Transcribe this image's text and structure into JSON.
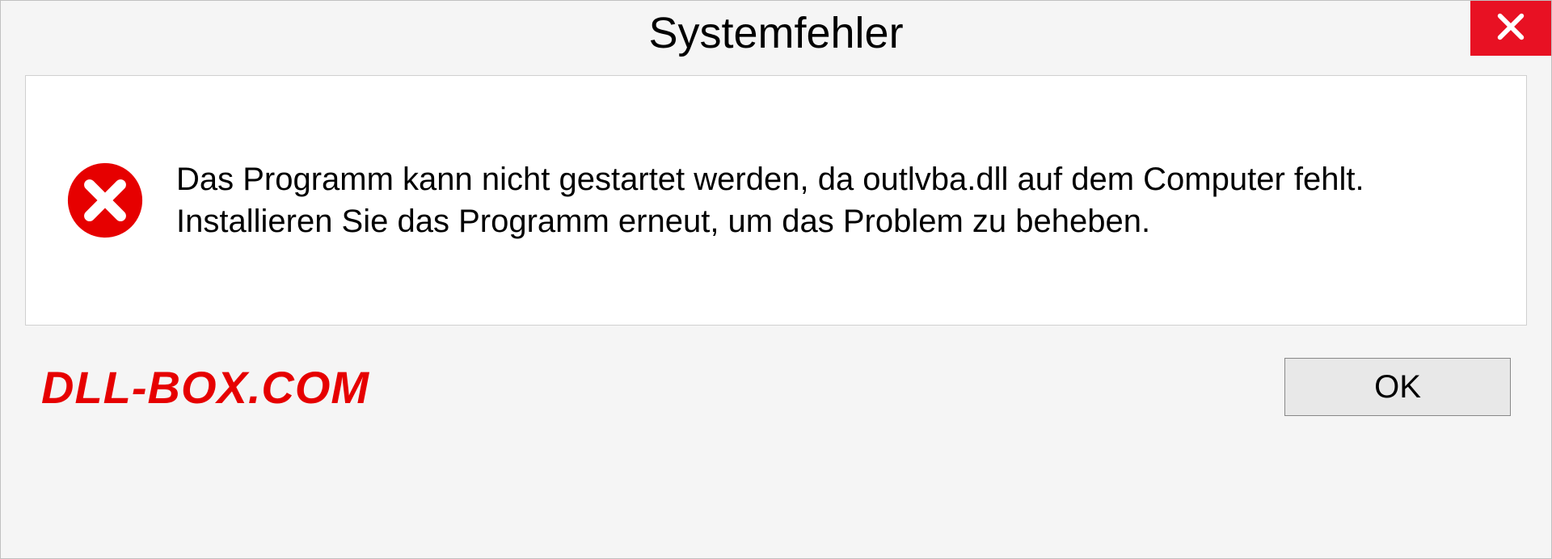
{
  "dialog": {
    "title": "Systemfehler",
    "message": "Das Programm kann nicht gestartet werden, da outlvba.dll auf dem Computer fehlt. Installieren Sie das Programm erneut, um das Problem zu beheben.",
    "ok_label": "OK"
  },
  "watermark": "DLL-BOX.COM"
}
